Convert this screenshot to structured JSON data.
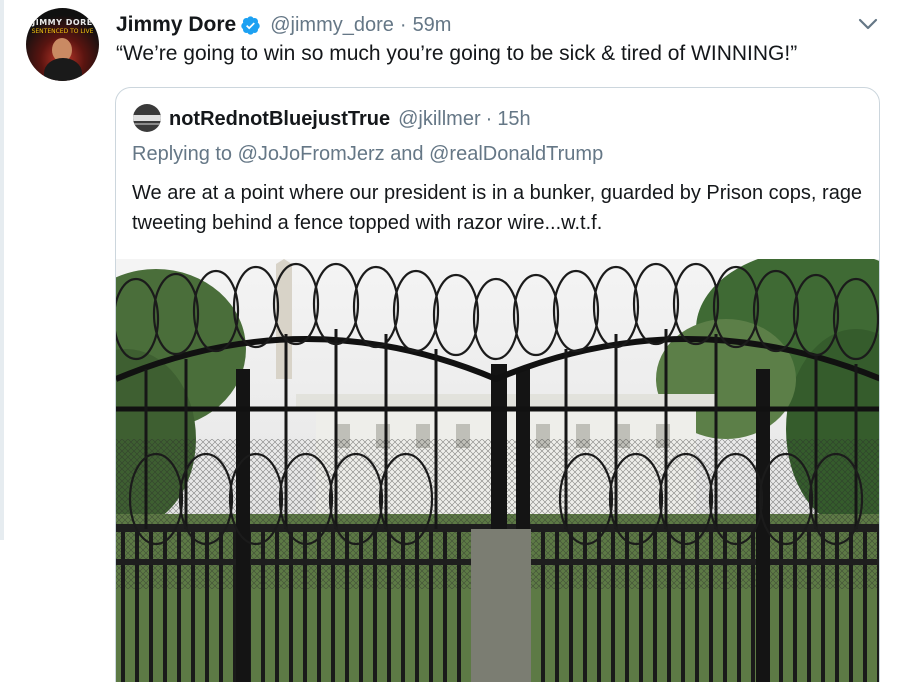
{
  "tweet": {
    "author_name": "Jimmy Dore",
    "handle": "@jimmy_dore",
    "separator": "·",
    "time": "59m",
    "text": "“We’re going to win so much you’re going to be sick & tired of WINNING!”",
    "avatar_text_top": "JIMMY DORE",
    "avatar_text_sub": "SENTENCED TO LIVE",
    "verified_color": "#1da1f2"
  },
  "quoted": {
    "author_name": "notRednotBluejustTrue",
    "handle": "@jkillmer",
    "separator": "·",
    "time": "15h",
    "replying_prefix": "Replying to",
    "mention_1": "@JoJoFromJerz",
    "mention_joiner": "and",
    "mention_2": "@realDonaldTrump",
    "text": "We are at a point where our president  is in a bunker, guarded by Prison cops, rage tweeting behind a fence topped with razor wire...w.t.f.",
    "image_icon": "photo-white-house-fence-razor-wire"
  },
  "icons": {
    "caret": "chevron-down-icon",
    "verified": "verified-badge-icon"
  }
}
